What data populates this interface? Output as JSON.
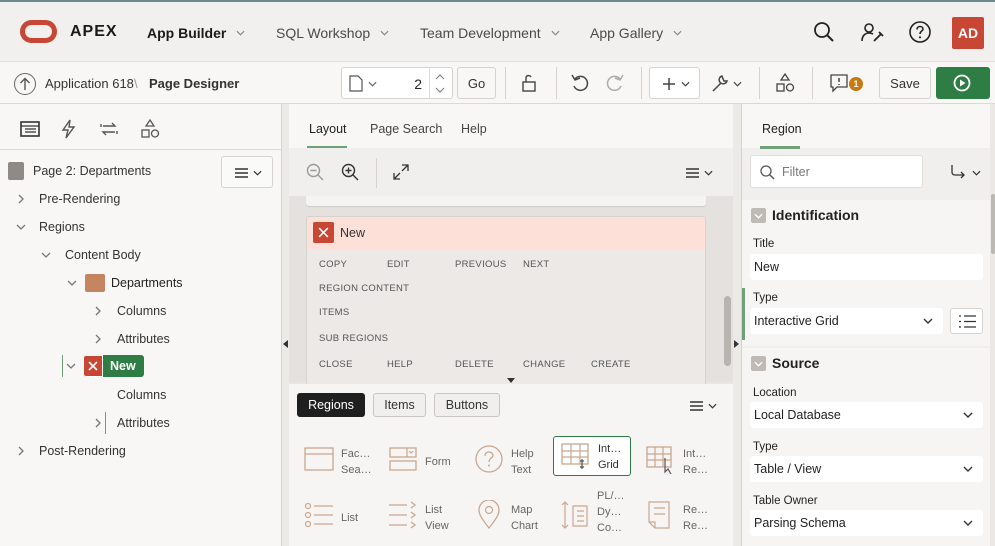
{
  "header": {
    "brand": "APEX",
    "nav": [
      {
        "label": "App Builder",
        "active": true
      },
      {
        "label": "SQL Workshop",
        "active": false
      },
      {
        "label": "Team Development",
        "active": false
      },
      {
        "label": "App Gallery",
        "active": false
      }
    ],
    "avatar_initials": "AD",
    "icons": [
      "search-icon",
      "admin-wrench-icon",
      "help-icon"
    ]
  },
  "toolbar": {
    "breadcrumb": {
      "app": "Application 618",
      "separator": "\\",
      "page": "Page Designer"
    },
    "page_number": "2",
    "go_label": "Go",
    "messages_count": "1",
    "save_label": "Save"
  },
  "left": {
    "tabs": [
      "rendering-icon",
      "dynamic-actions-icon",
      "processing-icon",
      "shared-components-icon"
    ],
    "tree": {
      "root": "Page 2: Departments",
      "items": [
        {
          "label": "Pre-Rendering"
        },
        {
          "label": "Regions"
        },
        {
          "label": "Content Body"
        },
        {
          "label": "Departments"
        },
        {
          "label": "Columns"
        },
        {
          "label": "Attributes"
        },
        {
          "label": "New"
        },
        {
          "label": "Columns"
        },
        {
          "label": "Attributes"
        },
        {
          "label": "Post-Rendering"
        }
      ]
    }
  },
  "center": {
    "tabs": [
      {
        "label": "Layout",
        "active": true
      },
      {
        "label": "Page Search",
        "active": false
      },
      {
        "label": "Help",
        "active": false
      }
    ],
    "region": {
      "title": "New",
      "slots_row1": [
        "COPY",
        "EDIT",
        "PREVIOUS",
        "NEXT"
      ],
      "slot_region_content": "REGION CONTENT",
      "slot_items": "ITEMS",
      "slot_sub_regions": "SUB REGIONS",
      "slots_row5": [
        "CLOSE",
        "HELP",
        "DELETE",
        "CHANGE",
        "CREATE"
      ]
    },
    "gallery": {
      "tabs": [
        {
          "label": "Regions",
          "active": true
        },
        {
          "label": "Items",
          "active": false
        },
        {
          "label": "Buttons",
          "active": false
        }
      ],
      "items": [
        {
          "line1": "Fac…",
          "line2": "Sea…",
          "line3": ""
        },
        {
          "line1": "Form",
          "line2": "",
          "line3": ""
        },
        {
          "line1": "Help",
          "line2": "Text",
          "line3": ""
        },
        {
          "line1": "Int…",
          "line2": "Grid",
          "line3": ""
        },
        {
          "line1": "Int…",
          "line2": "Re…",
          "line3": ""
        },
        {
          "line1": "List",
          "line2": "",
          "line3": ""
        },
        {
          "line1": "List",
          "line2": "View",
          "line3": ""
        },
        {
          "line1": "Map",
          "line2": "Chart",
          "line3": ""
        },
        {
          "line1": "PL/…",
          "line2": "Dy…",
          "line3": "Co…"
        },
        {
          "line1": "Re…",
          "line2": "Re…",
          "line3": ""
        }
      ]
    }
  },
  "right": {
    "tab": "Region",
    "filter_placeholder": "Filter",
    "identification": {
      "title": "Identification",
      "title_label": "Title",
      "title_value": "New",
      "type_label": "Type",
      "type_value": "Interactive Grid"
    },
    "source": {
      "title": "Source",
      "location_label": "Location",
      "location_value": "Local Database",
      "type_label": "Type",
      "type_value": "Table / View",
      "owner_label": "Table Owner",
      "owner_value": "Parsing Schema"
    }
  }
}
